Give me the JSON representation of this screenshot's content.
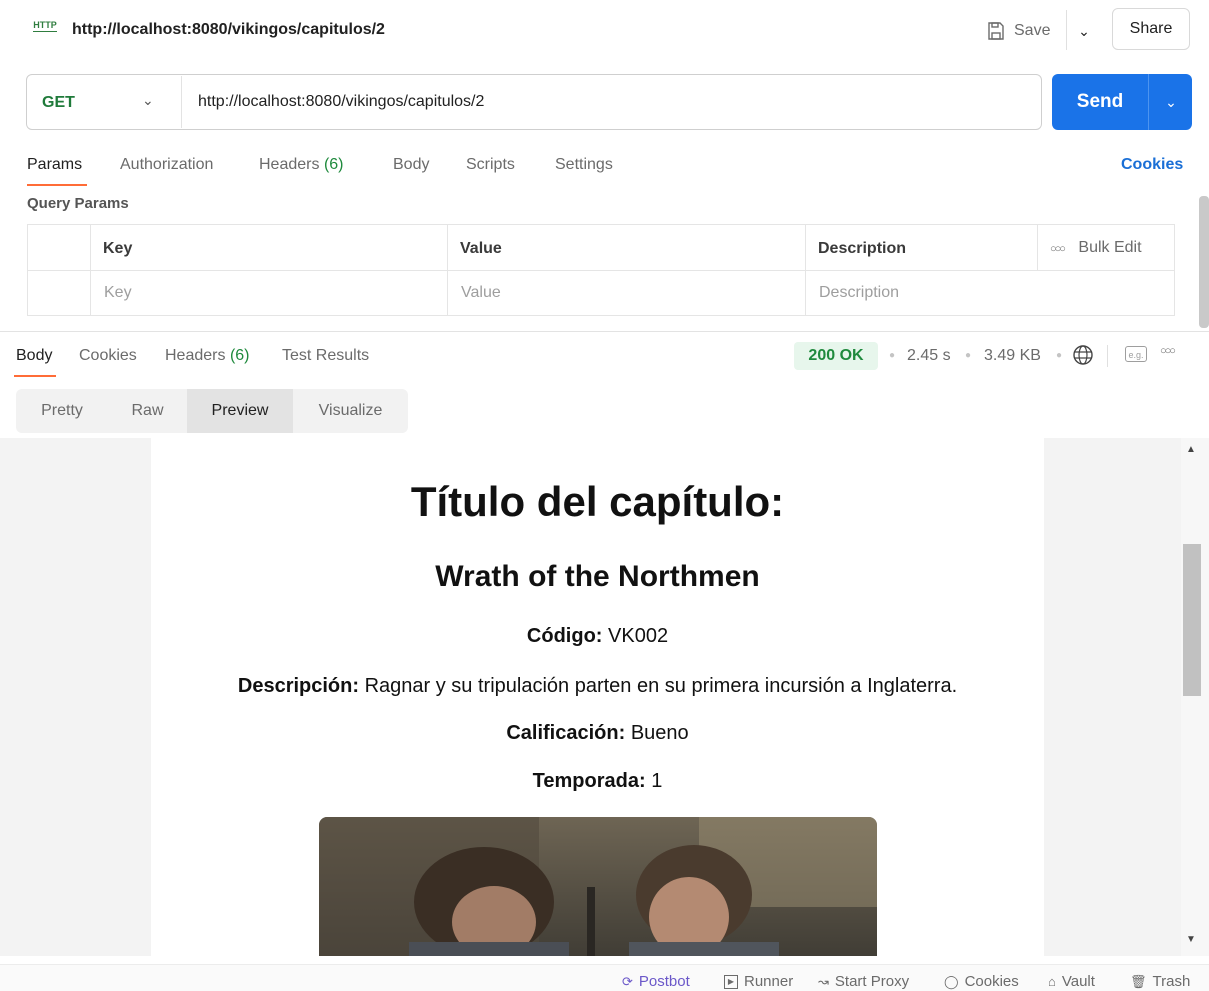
{
  "tab": {
    "title": "http://localhost:8080/vikingos/capitulos/2"
  },
  "toolbar": {
    "save_label": "Save",
    "share_label": "Share"
  },
  "request": {
    "method": "GET",
    "url": "http://localhost:8080/vikingos/capitulos/2",
    "send_label": "Send"
  },
  "request_tabs": {
    "params": "Params",
    "authorization": "Authorization",
    "headers": "Headers",
    "headers_count": "(6)",
    "body": "Body",
    "scripts": "Scripts",
    "settings": "Settings",
    "cookies": "Cookies"
  },
  "query_params": {
    "title": "Query Params",
    "headers": {
      "key": "Key",
      "value": "Value",
      "description": "Description"
    },
    "bulk_edit": "Bulk Edit",
    "placeholders": {
      "key": "Key",
      "value": "Value",
      "description": "Description"
    }
  },
  "response_tabs": {
    "body": "Body",
    "cookies": "Cookies",
    "headers": "Headers",
    "headers_count": "(6)",
    "test_results": "Test Results"
  },
  "response_meta": {
    "status": "200 OK",
    "time": "2.45 s",
    "size": "3.49 KB",
    "eg_label": "e.g."
  },
  "format_tabs": [
    "Pretty",
    "Raw",
    "Preview",
    "Visualize"
  ],
  "format_selected": "Preview",
  "preview": {
    "heading": "Título del capítulo:",
    "episode_title": "Wrath of the Northmen",
    "codigo_label": "Código:",
    "codigo_value": "VK002",
    "descripcion_label": "Descripción:",
    "descripcion_value": "Ragnar y su tripulación parten en su primera incursión a Inglaterra.",
    "calificacion_label": "Calificación:",
    "calificacion_value": "Bueno",
    "temporada_label": "Temporada:",
    "temporada_value": "1"
  },
  "footer": {
    "postbot": "Postbot",
    "runner": "Runner",
    "start_proxy": "Start Proxy",
    "cookies": "Cookies",
    "vault": "Vault",
    "trash": "Trash"
  },
  "colors": {
    "send": "#1a73e8",
    "method_get": "#1f7a3a",
    "active_tab": "#ff6c37",
    "status_ok": "#1f8a3d",
    "link": "#1a6fd6"
  }
}
